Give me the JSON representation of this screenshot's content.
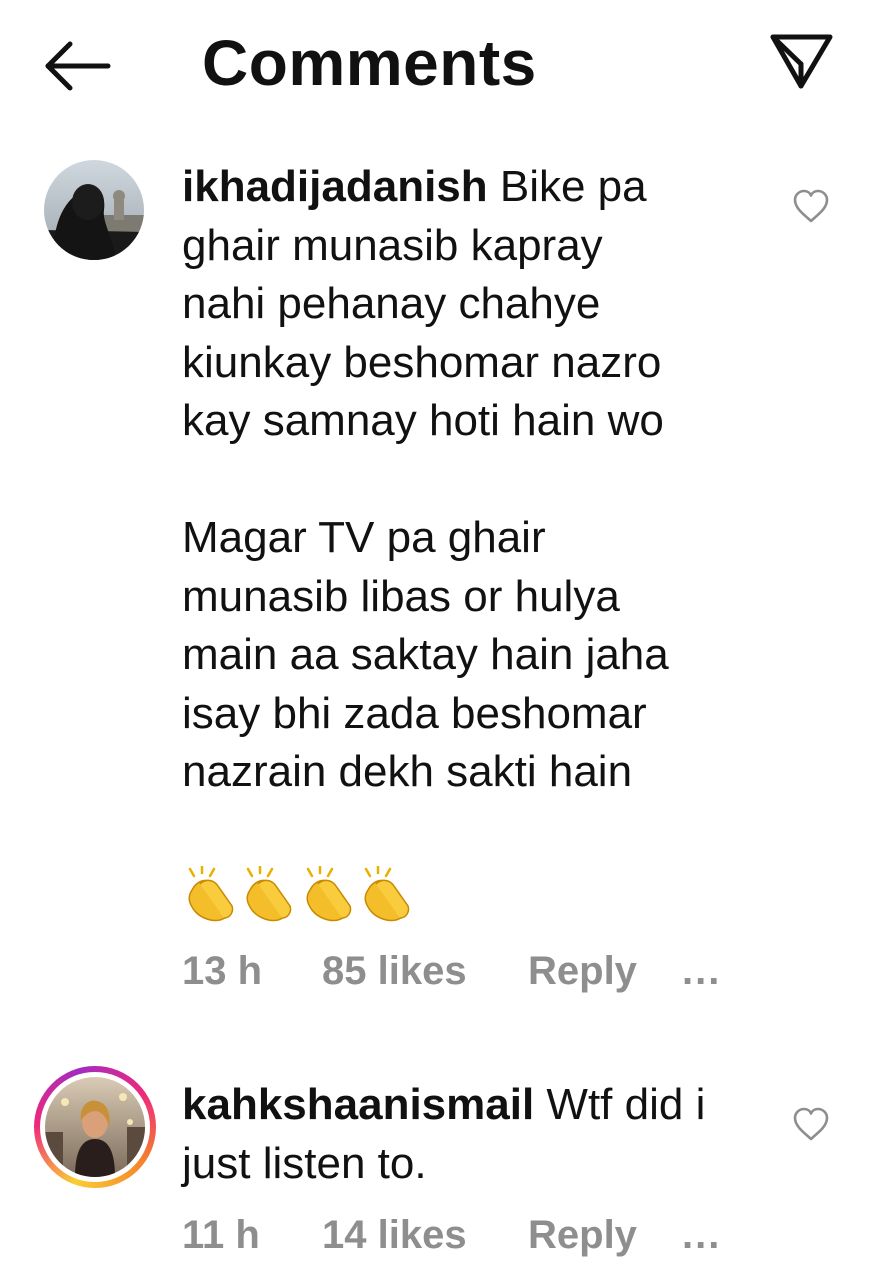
{
  "header": {
    "title": "Comments"
  },
  "comments": [
    {
      "username": "ikhadijadanish",
      "text": " Bike pa\nghair munasib kapray\nnahi pehanay chahye\nkiunkay beshomar nazro\nkay samnay hoti hain wo\n\nMagar TV pa ghair\nmunasib libas or hulya\nmain aa saktay hain jaha\nisay bhi zada beshomar\nnazrain dekh sakti hain",
      "emoji": "👏👏👏👏",
      "time": "13 h",
      "likes": "85 likes",
      "reply": "Reply",
      "more": "..."
    },
    {
      "username": "kahkshaanismail",
      "text": " Wtf did i\njust listen to.",
      "time": "11 h",
      "likes": "14 likes",
      "reply": "Reply",
      "more": "..."
    }
  ],
  "icons": {
    "back": "arrow-left-icon",
    "send": "paper-plane-icon",
    "like": "heart-outline-icon",
    "clap": "clapping-hands-icon"
  },
  "colors": {
    "meta_text": "#8e8e8e",
    "story_ring": "#ee2a7b"
  }
}
